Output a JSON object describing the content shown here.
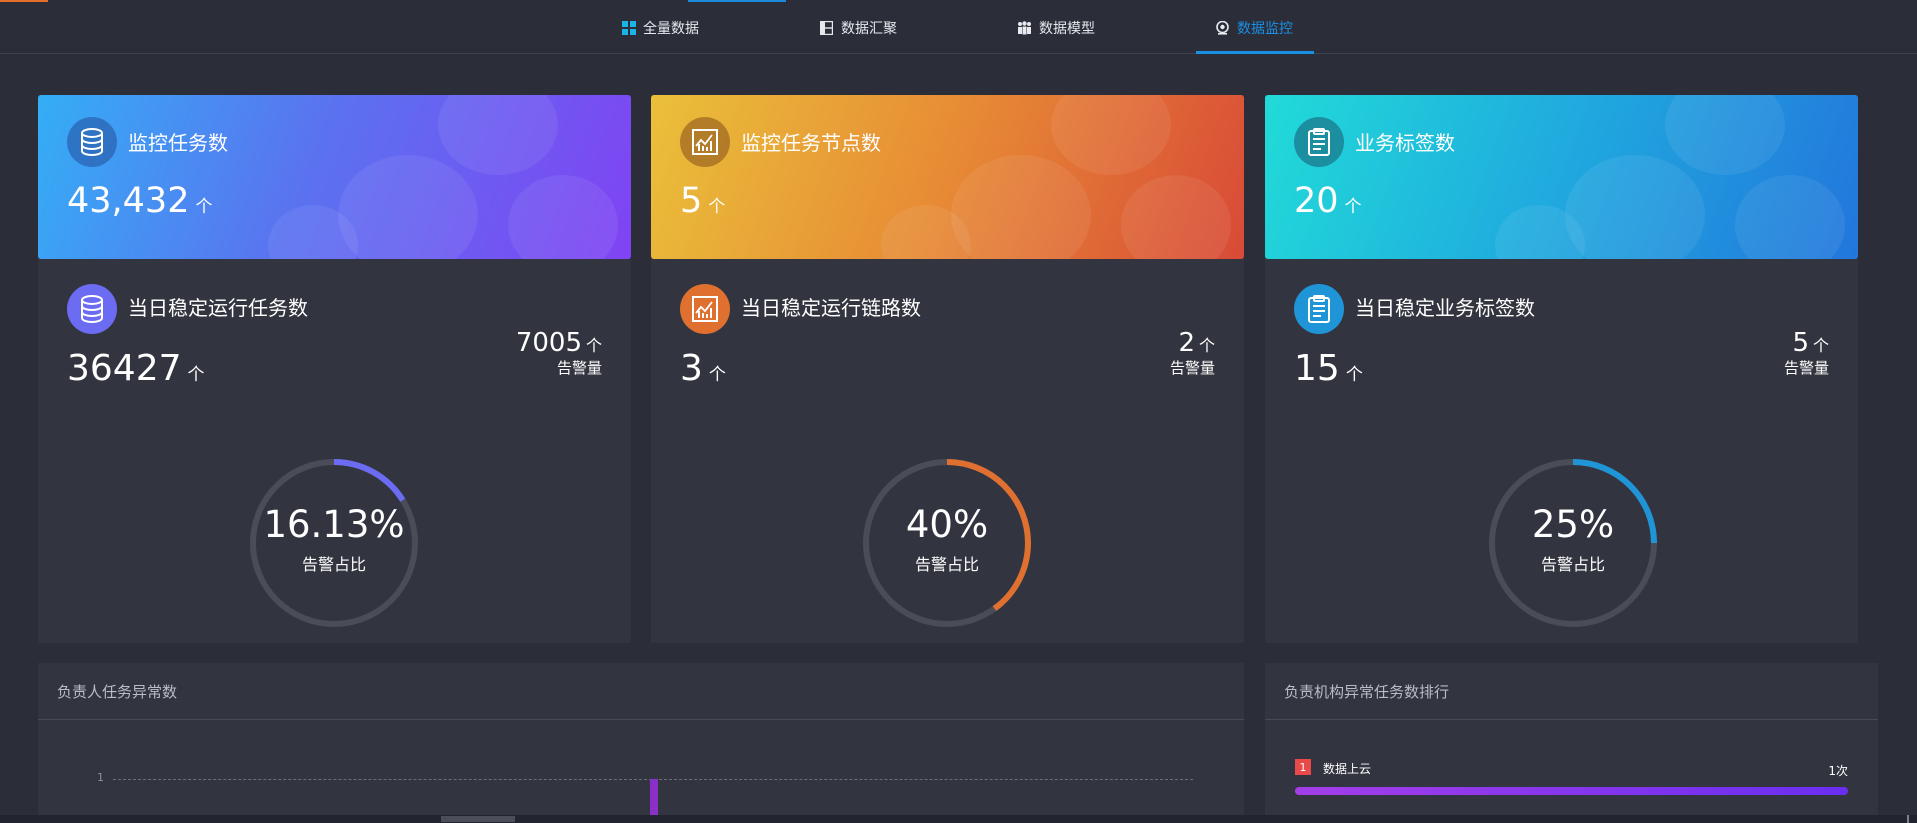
{
  "nav": {
    "items": [
      {
        "label": "全量数据",
        "icon": "grid-icon",
        "active": false
      },
      {
        "label": "数据汇聚",
        "icon": "layout-icon",
        "active": false
      },
      {
        "label": "数据模型",
        "icon": "people-icon",
        "active": false
      },
      {
        "label": "数据监控",
        "icon": "eye-icon",
        "active": true
      }
    ]
  },
  "cards": [
    {
      "head_title": "监控任务数",
      "head_value": "43,432",
      "head_unit": "个",
      "head_icon": "database-icon",
      "sub_title": "当日稳定运行任务数",
      "sub_value": "36427",
      "sub_unit": "个",
      "sub_icon": "database-icon",
      "alarm_value": "7005",
      "alarm_unit": "个",
      "alarm_label": "告警量",
      "gauge_percent": "16.13%",
      "gauge_fraction": 0.1613,
      "gauge_label": "告警占比",
      "accent": "#6b6cf2"
    },
    {
      "head_title": "监控任务节点数",
      "head_value": "5",
      "head_unit": "个",
      "head_icon": "chart-icon",
      "sub_title": "当日稳定运行链路数",
      "sub_value": "3",
      "sub_unit": "个",
      "sub_icon": "chart-icon",
      "alarm_value": "2",
      "alarm_unit": "个",
      "alarm_label": "告警量",
      "gauge_percent": "40%",
      "gauge_fraction": 0.4,
      "gauge_label": "告警占比",
      "accent": "#e07030"
    },
    {
      "head_title": "业务标签数",
      "head_value": "20",
      "head_unit": "个",
      "head_icon": "clipboard-icon",
      "sub_title": "当日稳定业务标签数",
      "sub_value": "15",
      "sub_unit": "个",
      "sub_icon": "clipboard-icon",
      "alarm_value": "5",
      "alarm_unit": "个",
      "alarm_label": "告警量",
      "gauge_percent": "25%",
      "gauge_fraction": 0.25,
      "gauge_label": "告警占比",
      "accent": "#1f95d8"
    }
  ],
  "panels": {
    "left_title": "负责人任务异常数",
    "right_title": "负责机构异常任务数排行"
  },
  "chart_data": {
    "type": "bar",
    "title": "负责人任务异常数",
    "y_ticks": [
      "1"
    ],
    "ylim": [
      0,
      1
    ],
    "values": [
      1
    ],
    "categories": [
      ""
    ]
  },
  "ranking": [
    {
      "rank": "1",
      "name": "数据上云",
      "count": "1次",
      "fraction": 1.0
    }
  ]
}
